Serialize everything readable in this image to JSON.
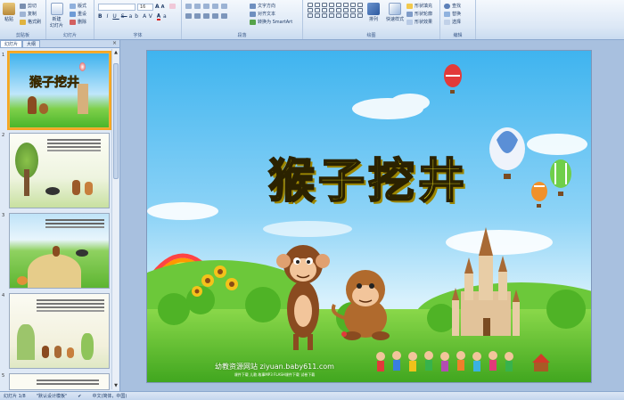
{
  "ribbon": {
    "clipboard": {
      "paste": "粘贴",
      "cut": "剪切",
      "copy": "复制",
      "format_painter": "格式刷",
      "label": "剪贴板"
    },
    "slides": {
      "new_slide": "新建\n幻灯片",
      "layout": "版式",
      "reset": "重设",
      "delete": "删除",
      "label": "幻灯片"
    },
    "font": {
      "font_name": "",
      "font_size": "16",
      "label": "字体"
    },
    "paragraph": {
      "text_direction": "文字方向",
      "align_text": "对齐文本",
      "convert_smartart": "转换为 SmartArt",
      "label": "段落"
    },
    "drawing": {
      "arrange": "排列",
      "quick_styles": "快速样式",
      "shape_fill": "形状填充",
      "shape_outline": "形状轮廓",
      "shape_effects": "形状效果",
      "label": "绘图"
    },
    "editing": {
      "find": "查找",
      "replace": "替换",
      "select": "选择",
      "label": "编辑"
    }
  },
  "left_panel": {
    "tab_slides": "幻灯片",
    "tab_outline": "大纲",
    "close": "×",
    "thumbnails": [
      {
        "number": "1",
        "title": "猴子挖井"
      },
      {
        "number": "2"
      },
      {
        "number": "3"
      },
      {
        "number": "4"
      },
      {
        "number": "5"
      }
    ]
  },
  "slide": {
    "title": "猴子挖井",
    "watermark_site": "幼教资源网站  ziyuan.baby611.com",
    "watermark_sub": "课件下载  儿歌  故事MP3  FLASH课件下载  试卷下载"
  },
  "status": {
    "slide_info": "幻灯片 1/8",
    "theme": "\"默认设计模板\"",
    "language": "中文(简体，中国)"
  },
  "colors": {
    "accent_selected": "#f5a623",
    "title_yellow": "#f5e31b",
    "sky_top": "#5bbcf0",
    "grass": "#5cc430"
  }
}
